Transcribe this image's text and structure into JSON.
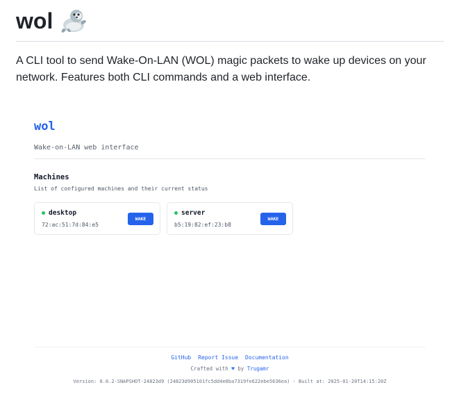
{
  "readme": {
    "title": "wol",
    "title_icon": "seal-emoji",
    "description": "A CLI tool to send Wake-On-LAN (WOL) magic packets to wake up devices on your network. Features both CLI commands and a web interface."
  },
  "app": {
    "title": "wol",
    "subtitle": "Wake-on-LAN web interface",
    "accent_color": "#2563eb",
    "section": {
      "title": "Machines",
      "description": "List of configured machines and their current status"
    },
    "machines": [
      {
        "name": "desktop",
        "mac": "72:ac:51:7d:84:e5",
        "status_color": "#22c55e",
        "button_label": "WAKE"
      },
      {
        "name": "server",
        "mac": "b5:19:82:ef:23:b8",
        "status_color": "#22c55e",
        "button_label": "WAKE"
      }
    ],
    "footer": {
      "links": [
        "GitHub",
        "Report Issue",
        "Documentation"
      ],
      "crafted_prefix": "Crafted with",
      "heart_icon": "heart-icon",
      "crafted_by": "by",
      "author": "Trugamr",
      "version": "Version: 0.0.2-SNAPSHOT-24823d9 (24823d905101fc5dd4e8ba7319fe622ebe5636ea) · Built at: 2025-01-20T14:15:20Z"
    }
  }
}
